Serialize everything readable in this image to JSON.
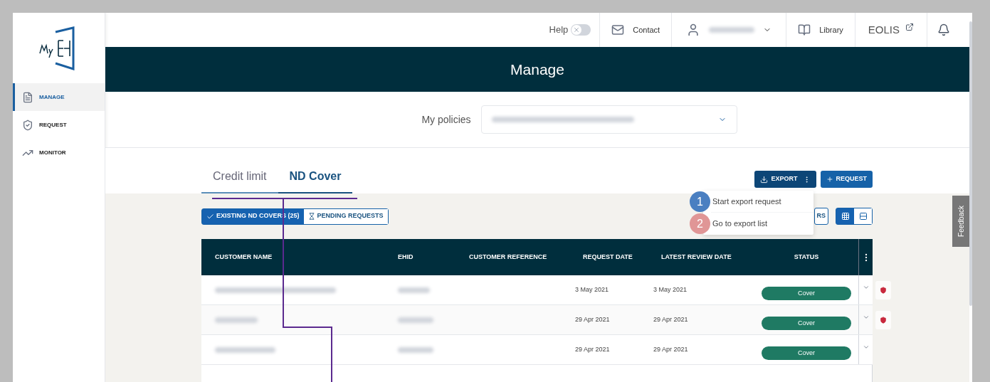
{
  "sidebar": {
    "items": [
      {
        "label": "MANAGE",
        "selected": true
      },
      {
        "label": "REQUEST",
        "selected": false
      },
      {
        "label": "MONITOR",
        "selected": false
      }
    ]
  },
  "topbar": {
    "help": {
      "label": "Help",
      "on": false
    },
    "contact": "Contact",
    "library": "Library",
    "eolis": "EOLIS"
  },
  "banner_title": "Manage",
  "policies": {
    "label": "My policies"
  },
  "tabs": [
    {
      "label": "Credit limit",
      "selected": false
    },
    {
      "label": "ND Cover",
      "selected": true
    }
  ],
  "actions": {
    "export": "EXPORT",
    "request": "REQUEST"
  },
  "export_menu": [
    {
      "number": "1",
      "label": "Start export request",
      "color": "#4a7fc1"
    },
    {
      "number": "2",
      "label": "Go to export list",
      "color": "#e09696"
    }
  ],
  "filters": [
    {
      "label": "EXISTING ND COVERS (25)",
      "selected": true
    },
    {
      "label": "PENDING REQUESTS",
      "selected": false
    }
  ],
  "covered_button": "RS",
  "view_toggle": [
    {
      "kind": "grid",
      "selected": true
    },
    {
      "kind": "list",
      "selected": false
    }
  ],
  "table": {
    "columns": [
      "CUSTOMER NAME",
      "EHID",
      "CUSTOMER REFERENCE",
      "REQUEST DATE",
      "LATEST REVIEW DATE",
      "STATUS"
    ],
    "rows": [
      {
        "request_date": "3 May 2021",
        "latest_review_date": "3 May 2021",
        "status": "Cover",
        "flagged": true
      },
      {
        "request_date": "29 Apr 2021",
        "latest_review_date": "29 Apr 2021",
        "status": "Cover",
        "flagged": true
      },
      {
        "request_date": "29 Apr 2021",
        "latest_review_date": "29 Apr 2021",
        "status": "Cover",
        "flagged": false
      }
    ]
  },
  "feedback": "Feedback"
}
